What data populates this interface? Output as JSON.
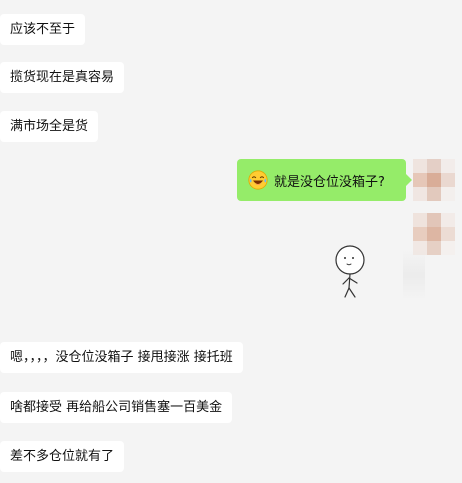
{
  "messages": [
    {
      "side": "left",
      "text": "应该不至于"
    },
    {
      "side": "left",
      "text": "揽货现在是真容易"
    },
    {
      "side": "left",
      "text": "满市场全是货"
    },
    {
      "side": "right",
      "text": "就是没仓位没箱子?",
      "emoji": "laughing-tears-emoji"
    },
    {
      "side": "right",
      "sticker": "stick-figure-sticker"
    },
    {
      "side": "left",
      "text": "嗯，，，，没仓位没箱子 接甩接涨  接托班"
    },
    {
      "side": "left",
      "text": "啥都接受  再给船公司销售塞一百美金"
    },
    {
      "side": "left",
      "text": "差不多仓位就有了"
    }
  ],
  "colors": {
    "background": "#f4f4f4",
    "left_bubble": "#ffffff",
    "right_bubble": "#95ec69"
  }
}
